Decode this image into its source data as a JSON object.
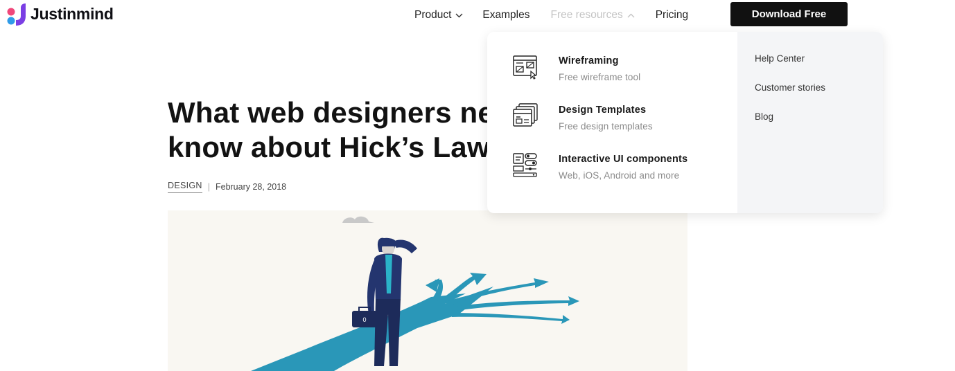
{
  "brand": {
    "name": "Justinmind",
    "colors": {
      "pink": "#f0477a",
      "purple": "#7b3fe4",
      "blue": "#2f9be8"
    }
  },
  "nav": {
    "items": [
      {
        "label": "Product",
        "has_chevron": true,
        "state": "normal"
      },
      {
        "label": "Examples",
        "has_chevron": false,
        "state": "normal"
      },
      {
        "label": "Free resources",
        "has_chevron": true,
        "state": "open"
      },
      {
        "label": "Pricing",
        "has_chevron": false,
        "state": "normal"
      }
    ],
    "cta_label": "Download Free"
  },
  "article": {
    "title_line1": "What web designers need to",
    "title_line2": "know about Hick’s Law",
    "category": "DESIGN",
    "separator": "|",
    "date": "February 28, 2018"
  },
  "dropdown": {
    "items": [
      {
        "title": "Wireframing",
        "subtitle": "Free wireframe tool",
        "icon": "wireframe-icon"
      },
      {
        "title": "Design Templates",
        "subtitle": "Free design templates",
        "icon": "templates-icon"
      },
      {
        "title": "Interactive UI components",
        "subtitle": "Web, iOS, Android and more",
        "icon": "ui-components-icon"
      }
    ],
    "side_links": [
      "Help Center",
      "Customer stories",
      "Blog"
    ]
  },
  "hero": {
    "briefcase_label": "0",
    "colors": {
      "sky": "#f9f7f2",
      "arrows": "#2a97b8",
      "suit": "#24356f",
      "tie": "#2ab3c8"
    }
  }
}
